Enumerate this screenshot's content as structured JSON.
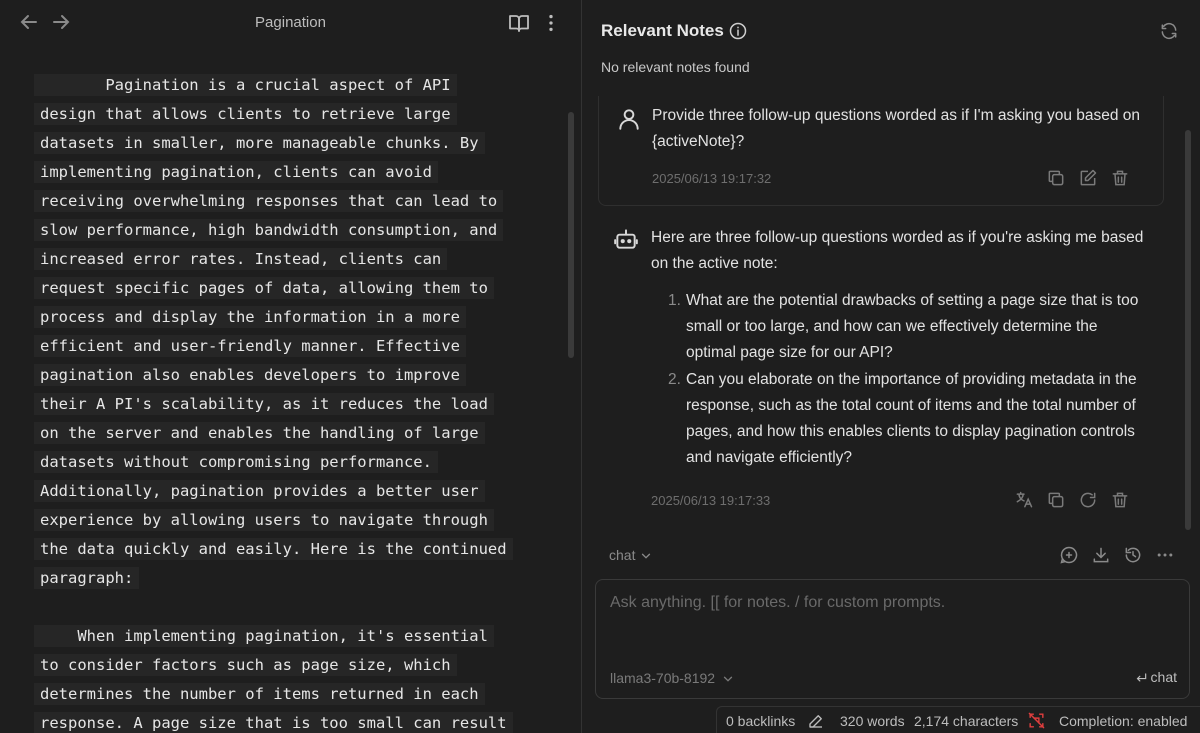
{
  "editor": {
    "title": "Pagination",
    "paragraph1": [
      "       Pagination is a crucial aspect of API",
      "design that allows clients to retrieve large",
      "datasets in smaller, more manageable chunks. By",
      "implementing pagination, clients can avoid",
      "receiving overwhelming responses that can lead to",
      "slow performance, high bandwidth consumption, and",
      "increased error rates. Instead, clients can",
      "request specific pages of data, allowing them to",
      "process and display the information in a more",
      "efficient and user-friendly manner. Effective",
      "pagination also enables developers to improve",
      "their A PI's scalability, as it reduces the load",
      "on the server and enables the handling of large",
      "datasets without compromising performance.",
      "Additionally, pagination provides a better user",
      "experience by allowing users to navigate through",
      "the data quickly and easily. Here is the continued",
      "paragraph:"
    ],
    "paragraph2": [
      "    When implementing pagination, it's essential",
      "to consider factors such as page size, which",
      "determines the number of items returned in each",
      "response. A page size that is too small can result"
    ]
  },
  "relevant_notes": {
    "title": "Relevant Notes",
    "empty_text": "No relevant notes found"
  },
  "chat": {
    "user_message": {
      "text": "Provide three follow-up questions worded as if I'm asking you based on {activeNote}?",
      "timestamp": "2025/06/13 19:17:32"
    },
    "bot_message": {
      "intro": "Here are three follow-up questions worded as if you're asking me based on the active note:",
      "items": [
        {
          "num": "1.",
          "text": "What are the potential drawbacks of setting a page size that is too small or too large, and how can we effectively determine the optimal page size for our API?"
        },
        {
          "num": "2.",
          "text": "Can you elaborate on the importance of providing metadata in the response, such as the total count of items and the total number of pages, and how this enables clients to display pagination controls and navigate efficiently?"
        }
      ],
      "timestamp": "2025/06/13 19:17:33"
    },
    "mode": "chat",
    "input_placeholder": "Ask anything. [[ for notes. / for custom prompts.",
    "model": "llama3-70b-8192",
    "send_label": "chat"
  },
  "statusbar": {
    "backlinks": "0 backlinks",
    "words": "320 words",
    "characters": "2,174 characters",
    "completion": "Completion: enabled"
  },
  "icons": [
    "arrow-left-icon",
    "arrow-right-icon",
    "book-open-icon",
    "more-vertical-icon",
    "info-icon",
    "refresh-icon",
    "user-icon",
    "bot-icon",
    "copy-icon",
    "edit-icon",
    "trash-icon",
    "translate-icon",
    "regenerate-icon",
    "chevron-down-icon",
    "new-chat-icon",
    "download-icon",
    "history-icon",
    "more-horizontal-icon",
    "enter-icon",
    "pencil-icon",
    "completion-off-icon"
  ],
  "colors": {
    "background": "#1e1e1e",
    "text": "#dadada",
    "muted": "#6e6e6e",
    "completion_icon": "#e03e3e"
  }
}
